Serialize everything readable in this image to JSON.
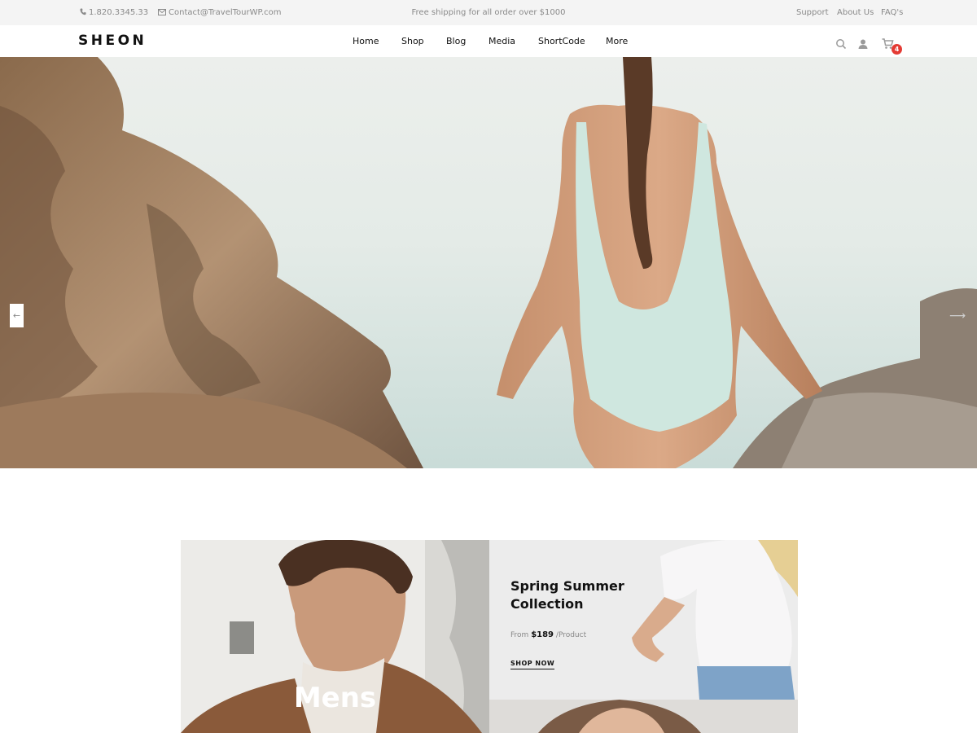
{
  "topbar": {
    "phone": "1.820.3345.33",
    "email": "Contact@TravelTourWP.com",
    "shipping": "Free shipping for all order over $1000",
    "links": [
      "Support",
      "About Us",
      "FAQ's"
    ]
  },
  "header": {
    "logo": "SHEON",
    "nav": [
      "Home",
      "Shop",
      "Blog",
      "Media",
      "ShortCode",
      "More"
    ],
    "cart_count": "4",
    "icons": [
      "search-icon",
      "user-icon",
      "cart-icon"
    ]
  },
  "hero": {
    "prev_arrow": "←",
    "next_arrow": "⟶"
  },
  "collections": {
    "mens_label": "Mens",
    "spring": {
      "title": "Spring Summer Collection",
      "price_prefix": "From",
      "price": "$189",
      "price_suffix": "/Product",
      "cta": "SHOP NOW"
    }
  },
  "colors": {
    "accent_badge": "#e43b34",
    "topbar_bg": "#f4f4f4",
    "text_dark": "#111111",
    "text_muted": "#8a8a8a"
  }
}
